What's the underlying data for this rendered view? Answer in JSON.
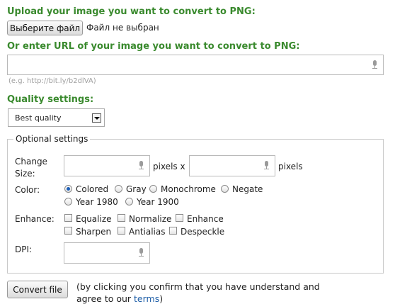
{
  "upload": {
    "heading": "Upload your image you want to convert to PNG:",
    "choose_button": "Выберите файл",
    "no_file": "Файл не выбран"
  },
  "url": {
    "heading": "Or enter URL of your image you want to convert to PNG:",
    "value": "",
    "hint": "(e.g. http://bit.ly/b2dlVA)"
  },
  "quality": {
    "heading": "Quality settings:",
    "selected": "Best quality"
  },
  "optional": {
    "legend": "Optional settings",
    "change_size_label_1": "Change",
    "change_size_label_2": "Size:",
    "pixels_x": "pixels x",
    "pixels": "pixels",
    "color_label": "Color:",
    "color_options": [
      "Colored",
      "Gray",
      "Monochrome",
      "Negate",
      "Year 1980",
      "Year 1900"
    ],
    "color_selected": "Colored",
    "enhance_label": "Enhance:",
    "enhance_options": [
      "Equalize",
      "Normalize",
      "Enhance",
      "Sharpen",
      "Antialias",
      "Despeckle"
    ],
    "dpi_label": "DPI:"
  },
  "convert": {
    "button": "Convert file",
    "note_line1": "(by clicking you confirm that you have understand and",
    "note_line2_prefix": "agree to our ",
    "terms_link": "terms",
    "note_line2_suffix": ")"
  },
  "colors": {
    "heading_green": "#3a8a2e",
    "link_blue": "#1f5fa8",
    "radio_selected": "#1c5fb8"
  }
}
